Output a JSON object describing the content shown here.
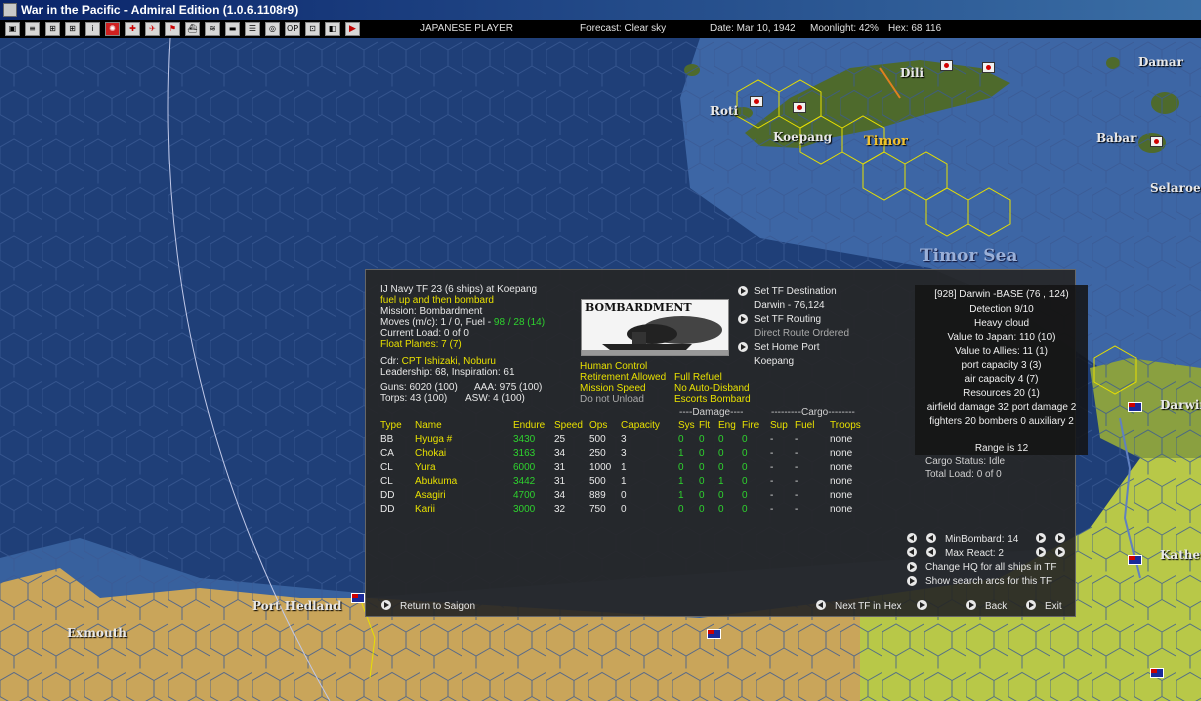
{
  "window": {
    "title": "War in the Pacific - Admiral Edition (1.0.6.1108r9)"
  },
  "toolbar": {
    "player": "JAPANESE PLAYER",
    "forecast": "Forecast: Clear sky",
    "date": "Date: Mar 10, 1942",
    "moonlight": "Moonlight: 42%",
    "hex": "Hex: 68 116",
    "button_icons": [
      "list-icon",
      "report-icon",
      "ships-icon",
      "planes-icon",
      "info-icon",
      "rising-sun-icon",
      "air-icon",
      "ground-icon",
      "flag-icon",
      "ship-icon",
      "base-icon",
      "sub-icon",
      "convoy-icon",
      "radar-icon",
      "op-icon",
      "report2-icon",
      "options-icon",
      "end-turn-icon"
    ]
  },
  "map": {
    "places": {
      "dili": "Dili",
      "roti": "Roti",
      "koepang": "Koepang",
      "timor": "Timor",
      "damar": "Damar",
      "babar": "Babar",
      "selaroe": "Selaroe",
      "timor_sea": "Timor Sea",
      "darwin": "Darwin",
      "katherine": "Kather",
      "port_hedland": "Port Hedland",
      "exmouth": "Exmouth"
    },
    "colors": {
      "sea": "#1f3f78",
      "land_green": "#6b8a35",
      "land_yellow": "#d8d060",
      "hex_path": "#e8e000"
    }
  },
  "tf": {
    "header": "IJ Navy TF 23 (6 ships) at Koepang",
    "orders": "fuel up and then bombard",
    "mission": "Mission: Bombardment",
    "moves_prefix": "Moves (m/c): 1 / 0, Fuel - ",
    "fuel": "98 / 28 (14)",
    "current_load": "Current Load: 0 of 0",
    "float_planes": "Float Planes: 7 (7)",
    "cdr_prefix": "Cdr: ",
    "cdr": "CPT Ishizaki, Noburu",
    "leadership": "Leadership: 68, Inspiration: 61",
    "guns": "Guns: 6020 (100)",
    "aaa": "AAA: 975 (100)",
    "torps": "Torps: 43 (100)",
    "asw": "ASW: 4 (100)",
    "mission_image_label": "BOMBARDMENT",
    "status": {
      "human_control": "Human Control",
      "full_refuel": "Full Refuel",
      "retirement": "Retirement Allowed",
      "no_auto_disband": "No Auto-Disband",
      "mission_speed": "Mission Speed",
      "escorts_bombard": "Escorts Bombard",
      "do_not_unload": "Do not Unload"
    },
    "destination": {
      "set_label": "Set TF Destination",
      "value": "Darwin - 76,124",
      "routing_label": "Set TF Routing",
      "routing_value": "Direct Route Ordered",
      "home_label": "Set Home Port",
      "home_value": "Koepang"
    },
    "table": {
      "group_damage": "----Damage----",
      "group_cargo": "---------Cargo--------",
      "headers": [
        "Type",
        "Name",
        "Endure",
        "Speed",
        "Ops",
        "Capacity",
        "Sys",
        "Flt",
        "Eng",
        "Fire",
        "Sup",
        "Fuel",
        "Troops"
      ],
      "rows": [
        [
          "BB",
          "Hyuga #",
          "3430",
          "25",
          "500",
          "3",
          "0",
          "0",
          "0",
          "0",
          "-",
          "-",
          "none"
        ],
        [
          "CA",
          "Chokai",
          "3163",
          "34",
          "250",
          "3",
          "1",
          "0",
          "0",
          "0",
          "-",
          "-",
          "none"
        ],
        [
          "CL",
          "Yura",
          "6000",
          "31",
          "1000",
          "1",
          "0",
          "0",
          "0",
          "0",
          "-",
          "-",
          "none"
        ],
        [
          "CL",
          "Abukuma",
          "3442",
          "31",
          "500",
          "1",
          "1",
          "0",
          "1",
          "0",
          "-",
          "-",
          "none"
        ],
        [
          "DD",
          "Asagiri",
          "4700",
          "34",
          "889",
          "0",
          "1",
          "0",
          "0",
          "0",
          "-",
          "-",
          "none"
        ],
        [
          "DD",
          "Karii",
          "3000",
          "32",
          "750",
          "0",
          "0",
          "0",
          "0",
          "0",
          "-",
          "-",
          "none"
        ]
      ]
    },
    "cargo_status": "Cargo Status: Idle",
    "total_load": "Total Load: 0 of 0",
    "min_bombard": "MinBombard: 14",
    "max_react": "Max React: 2",
    "change_hq": "Change HQ for all ships in TF",
    "show_search_arcs": "Show search arcs for this TF",
    "return_to": "Return to Saigon",
    "next_tf": "Next TF in Hex",
    "back": "Back",
    "exit": "Exit"
  },
  "base_popup": {
    "title": "[928] Darwin -BASE (76 , 124)",
    "detection": "Detection 9/10",
    "weather": "Heavy cloud",
    "value_japan": "Value to Japan: 110 (10)",
    "value_allies": "Value to Allies: 11 (1)",
    "port_capacity": "port capacity 3 (3)",
    "air_capacity": "air capacity 4 (7)",
    "resources": "Resources 20 (1)",
    "damage": "airfield damage 32 port damage 2",
    "aircraft": "fighters 20 bombers 0 auxiliary 2",
    "range": "Range is 12"
  }
}
